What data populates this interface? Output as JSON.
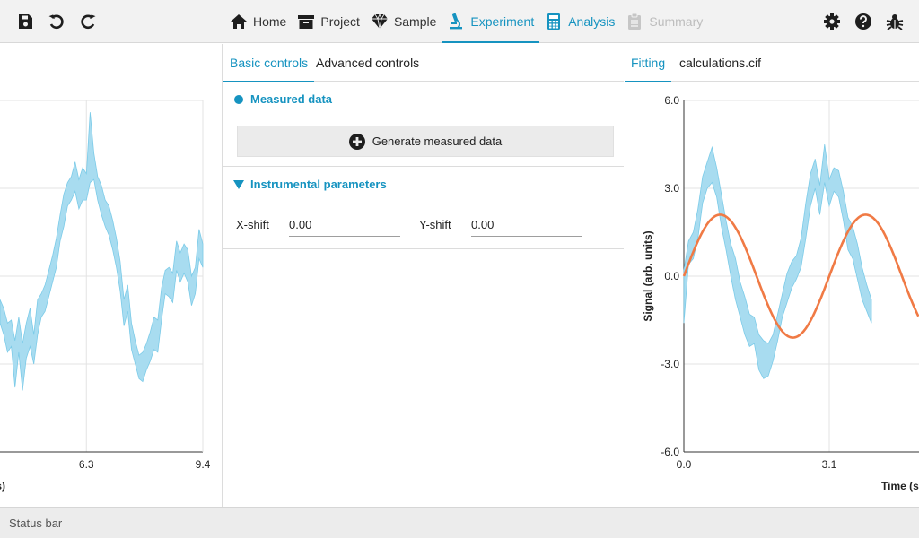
{
  "toolbar": {
    "left_icons": [
      "save-icon",
      "undo-icon",
      "redo-icon"
    ],
    "right_icons": [
      "settings-icon",
      "help-icon",
      "bug-icon"
    ],
    "tabs": [
      {
        "label": "Home",
        "icon": "home-icon",
        "state": "normal"
      },
      {
        "label": "Project",
        "icon": "archive-icon",
        "state": "normal"
      },
      {
        "label": "Sample",
        "icon": "gem-icon",
        "state": "normal"
      },
      {
        "label": "Experiment",
        "icon": "microscope-icon",
        "state": "active"
      },
      {
        "label": "Analysis",
        "icon": "calculator-icon",
        "state": "normal"
      },
      {
        "label": "Summary",
        "icon": "clipboard-icon",
        "state": "disabled"
      }
    ],
    "accent_color": "#1693c0",
    "disabled_color": "#bdbdbd"
  },
  "middle": {
    "tabs": [
      {
        "label": "Basic controls",
        "active": true
      },
      {
        "label": "Advanced controls",
        "active": false
      }
    ],
    "measured_data": {
      "title": "Measured data",
      "button_label": "Generate measured data"
    },
    "instrumental": {
      "title": "Instrumental parameters",
      "x_shift_label": "X-shift",
      "x_shift_value": "0.00",
      "y_shift_label": "Y-shift",
      "y_shift_value": "0.00"
    }
  },
  "right": {
    "tabs": [
      {
        "label": "Fitting",
        "active": true
      },
      {
        "label": "calculations.cif",
        "active": false
      }
    ]
  },
  "status_bar": {
    "text": "Status bar"
  },
  "chart_data": [
    {
      "type": "area",
      "description_of_visible_part": "left panel plot (cropped), measured data band",
      "xlabel": "s)",
      "x_ticks": [
        "6.3",
        "9.4"
      ],
      "x_tick_values": [
        6.3,
        9.4
      ],
      "xlim": [
        4.0,
        9.4
      ],
      "ylim": [
        -6.0,
        6.0
      ],
      "y_grid": [
        -6.0,
        -3.0,
        0.0,
        3.0,
        6.0
      ],
      "band_color": "#a8dcf0",
      "band_stroke": "#7ccbe8",
      "series": [
        {
          "x": [
            4.0,
            4.1,
            4.2,
            4.3,
            4.4,
            4.5,
            4.6,
            4.7,
            4.8,
            4.9,
            5.0,
            5.1,
            5.2,
            5.3,
            5.4,
            5.5,
            5.6,
            5.7,
            5.8,
            5.9,
            6.0,
            6.1,
            6.2,
            6.3,
            6.4,
            6.5,
            6.6,
            6.7,
            6.8,
            6.9,
            7.0,
            7.1,
            7.2,
            7.3,
            7.4,
            7.5,
            7.6,
            7.7,
            7.8,
            7.9,
            8.0,
            8.1,
            8.2,
            8.3,
            8.4,
            8.5,
            8.6,
            8.7,
            8.8,
            8.9,
            9.0,
            9.1,
            9.2,
            9.3,
            9.4
          ],
          "upper": [
            -0.8,
            -1.1,
            -1.6,
            -1.5,
            -2.2,
            -1.4,
            -2.3,
            -1.6,
            -1.1,
            -2.0,
            -0.8,
            -0.6,
            -0.3,
            0.2,
            0.7,
            1.3,
            2.1,
            2.8,
            3.2,
            3.4,
            3.9,
            3.3,
            3.7,
            3.5,
            5.6,
            4.2,
            3.4,
            3.1,
            2.6,
            2.4,
            1.9,
            1.3,
            0.5,
            -0.8,
            -0.3,
            -1.6,
            -2.2,
            -2.7,
            -2.6,
            -2.3,
            -1.9,
            -1.4,
            -1.5,
            -0.4,
            0.2,
            0.3,
            0.1,
            1.2,
            0.8,
            1.1,
            0.9,
            0.0,
            0.3,
            1.6,
            1.1
          ],
          "lower": [
            -1.6,
            -2.0,
            -2.6,
            -2.4,
            -3.8,
            -2.6,
            -3.9,
            -2.8,
            -2.4,
            -3.0,
            -2.0,
            -1.4,
            -1.2,
            -0.7,
            -0.2,
            0.3,
            1.2,
            1.7,
            2.4,
            2.6,
            2.9,
            2.3,
            2.6,
            2.6,
            3.2,
            3.3,
            2.6,
            2.1,
            1.7,
            1.4,
            0.9,
            0.3,
            -0.5,
            -1.7,
            -1.2,
            -2.5,
            -3.0,
            -3.5,
            -3.6,
            -3.2,
            -2.9,
            -2.5,
            -2.6,
            -1.5,
            -0.6,
            -0.7,
            -0.9,
            0.2,
            -0.2,
            0.1,
            -0.2,
            -1.0,
            -0.6,
            0.6,
            0.3
          ]
        }
      ]
    },
    {
      "type": "line",
      "description_of_visible_part": "right panel plot (cropped), measured band with fitted curve",
      "xlabel": "Time (s",
      "ylabel": "Signal (arb. units)",
      "x_ticks": [
        "0.0",
        "3.1"
      ],
      "x_tick_values": [
        0.0,
        3.1
      ],
      "y_ticks": [
        "6.0",
        "3.0",
        "0.0",
        "-3.0",
        "-6.0"
      ],
      "y_tick_values": [
        6.0,
        3.0,
        0.0,
        -3.0,
        -6.0
      ],
      "xlim": [
        0.0,
        5.0
      ],
      "ylim": [
        -6.0,
        6.0
      ],
      "band_color": "#a8dcf0",
      "band_stroke": "#7ccbe8",
      "fit_color": "#f07a45",
      "series": [
        {
          "name": "measured",
          "x": [
            0.0,
            0.1,
            0.2,
            0.3,
            0.4,
            0.5,
            0.6,
            0.7,
            0.8,
            0.9,
            1.0,
            1.1,
            1.2,
            1.3,
            1.4,
            1.5,
            1.6,
            1.7,
            1.8,
            1.9,
            2.0,
            2.1,
            2.2,
            2.3,
            2.4,
            2.5,
            2.6,
            2.7,
            2.8,
            2.9,
            3.0,
            3.1,
            3.2,
            3.3,
            3.4,
            3.5,
            3.6,
            3.7,
            3.8,
            3.9,
            4.0,
            4.1,
            4.2,
            4.3,
            4.4,
            4.5,
            4.6,
            4.7,
            4.8,
            4.9,
            5.0
          ],
          "upper": [
            0.2,
            1.2,
            1.5,
            2.3,
            3.4,
            3.9,
            4.4,
            3.7,
            2.8,
            1.9,
            1.1,
            0.6,
            -0.2,
            -0.7,
            -1.3,
            -1.4,
            -2.0,
            -2.2,
            -2.3,
            -2.0,
            -1.3,
            -0.6,
            0.1,
            0.5,
            0.7,
            1.3,
            2.5,
            3.5,
            4.0,
            3.1,
            4.5,
            3.3,
            3.7,
            3.6,
            2.9,
            2.0,
            1.7,
            1.1,
            0.3,
            -0.3,
            -0.8
          ],
          "lower": [
            -1.6,
            0.4,
            0.6,
            1.3,
            2.5,
            3.0,
            3.2,
            2.7,
            1.7,
            0.9,
            0.0,
            -0.8,
            -1.4,
            -2.0,
            -2.4,
            -2.3,
            -3.2,
            -3.5,
            -3.4,
            -2.9,
            -2.2,
            -1.4,
            -0.9,
            -0.4,
            -0.1,
            0.3,
            1.3,
            2.4,
            3.0,
            2.1,
            3.2,
            2.4,
            2.9,
            2.7,
            1.9,
            0.9,
            0.6,
            -0.1,
            -0.8,
            -1.2,
            -1.6
          ],
          "upper_x_max": 4.0
        },
        {
          "name": "fit",
          "amplitude": 2.1,
          "period": 3.1,
          "x_start": 0.0,
          "x_end": 5.0
        }
      ]
    }
  ]
}
